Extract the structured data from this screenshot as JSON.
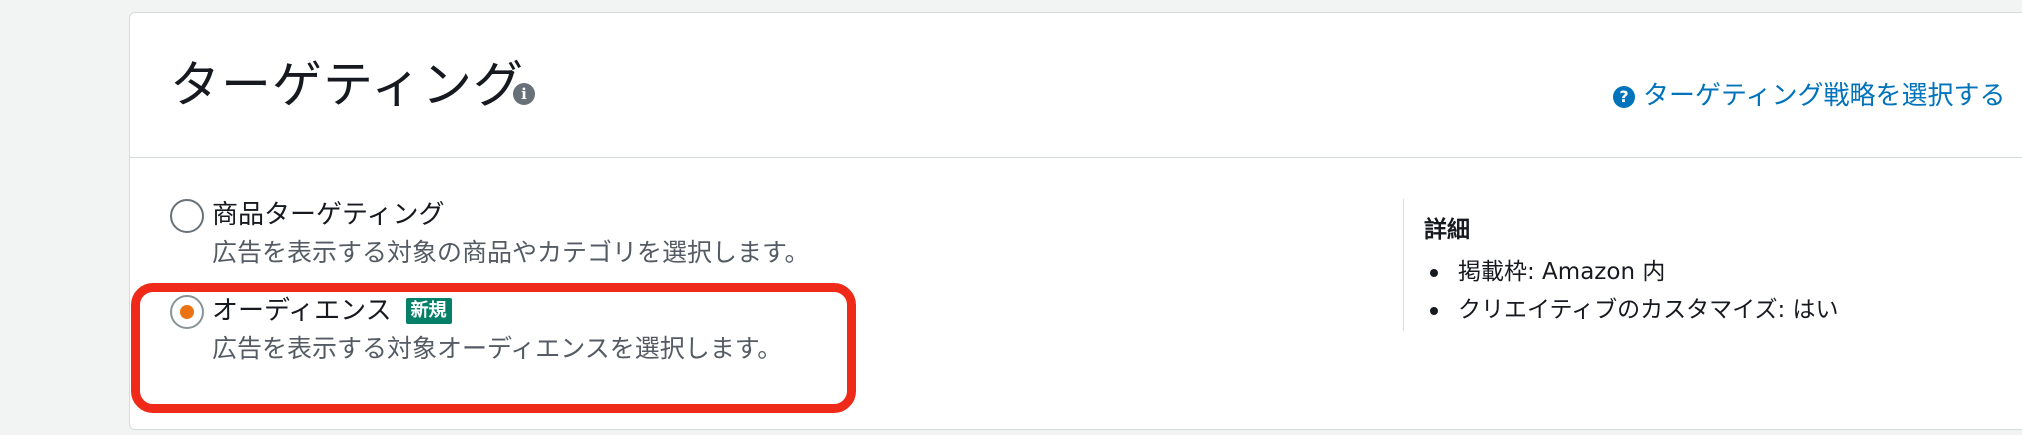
{
  "header": {
    "title": "ターゲティング",
    "info_icon": "info-icon",
    "strategy_link": "ターゲティング戦略を選択する",
    "help_icon": "help-icon"
  },
  "options": [
    {
      "label": "商品ターゲティング",
      "description": "広告を表示する対象の商品やカテゴリを選択します。",
      "selected": false
    },
    {
      "label": "オーディエンス",
      "badge": "新規",
      "description": "広告を表示する対象オーディエンスを選択します。",
      "selected": true
    }
  ],
  "details": {
    "title": "詳細",
    "items": [
      "掲載枠: Amazon 内",
      "クリエイティブのカスタマイズ: はい"
    ]
  },
  "colors": {
    "link": "#0073bb",
    "radio_selected": "#ec7211",
    "badge": "#067f68",
    "highlight": "#ef2a18"
  }
}
